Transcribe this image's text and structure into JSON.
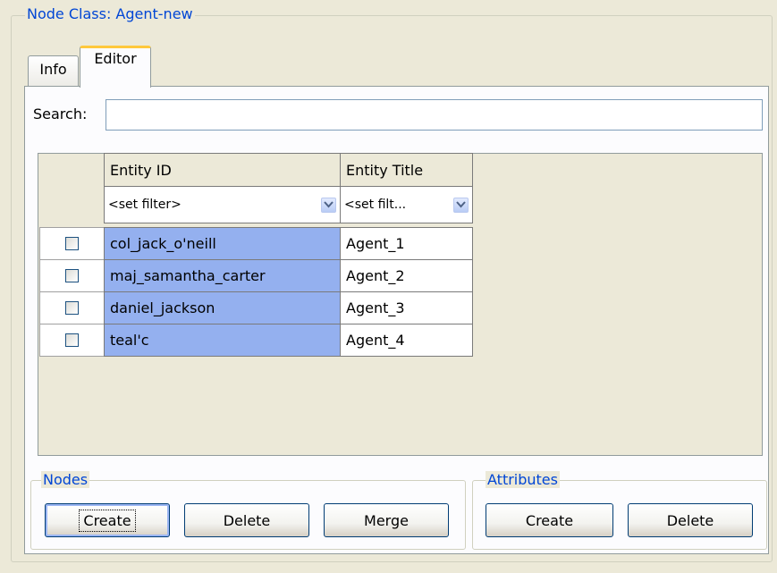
{
  "group": {
    "title": "Node Class: Agent-new"
  },
  "tabs": [
    {
      "label": "Info",
      "active": false
    },
    {
      "label": "Editor",
      "active": true
    }
  ],
  "search": {
    "label": "Search:",
    "value": ""
  },
  "table": {
    "columns": [
      {
        "header": "Entity ID",
        "filter": "<set filter>"
      },
      {
        "header": "Entity Title",
        "filter": "<set filt..."
      }
    ],
    "rows": [
      {
        "checked": false,
        "id": "col_jack_o'neill",
        "title": "Agent_1"
      },
      {
        "checked": false,
        "id": "maj_samantha_carter",
        "title": "Agent_2"
      },
      {
        "checked": false,
        "id": "daniel_jackson",
        "title": "Agent_3"
      },
      {
        "checked": false,
        "id": "teal'c",
        "title": "Agent_4"
      }
    ]
  },
  "nodes": {
    "title": "Nodes",
    "buttons": {
      "create": "Create",
      "delete": "Delete",
      "merge": "Merge"
    }
  },
  "attributes": {
    "title": "Attributes",
    "buttons": {
      "create": "Create",
      "delete": "Delete"
    }
  },
  "colors": {
    "accent": "#0046d5",
    "selection": "#94b0ef",
    "tab_highlight": "#ffc83c"
  },
  "icons": {
    "dropdown": "chevron-down-icon",
    "checkbox": "checkbox-icon"
  }
}
